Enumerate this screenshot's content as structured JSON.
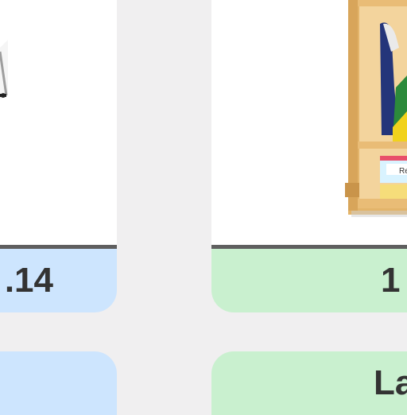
{
  "cards": [
    {
      "image_subject": "easel-partial",
      "value": ".14",
      "bottom_label": ""
    },
    {
      "image_subject": "cubby-shelf-partial",
      "value": "1",
      "bottom_label": "La",
      "shelf_tag": "Re"
    }
  ],
  "colors": {
    "background": "#f0eff0",
    "blue_pill": "#cde5fe",
    "green_pill": "#c9f0cf",
    "divider": "#5f5f5f",
    "text": "#333333"
  }
}
